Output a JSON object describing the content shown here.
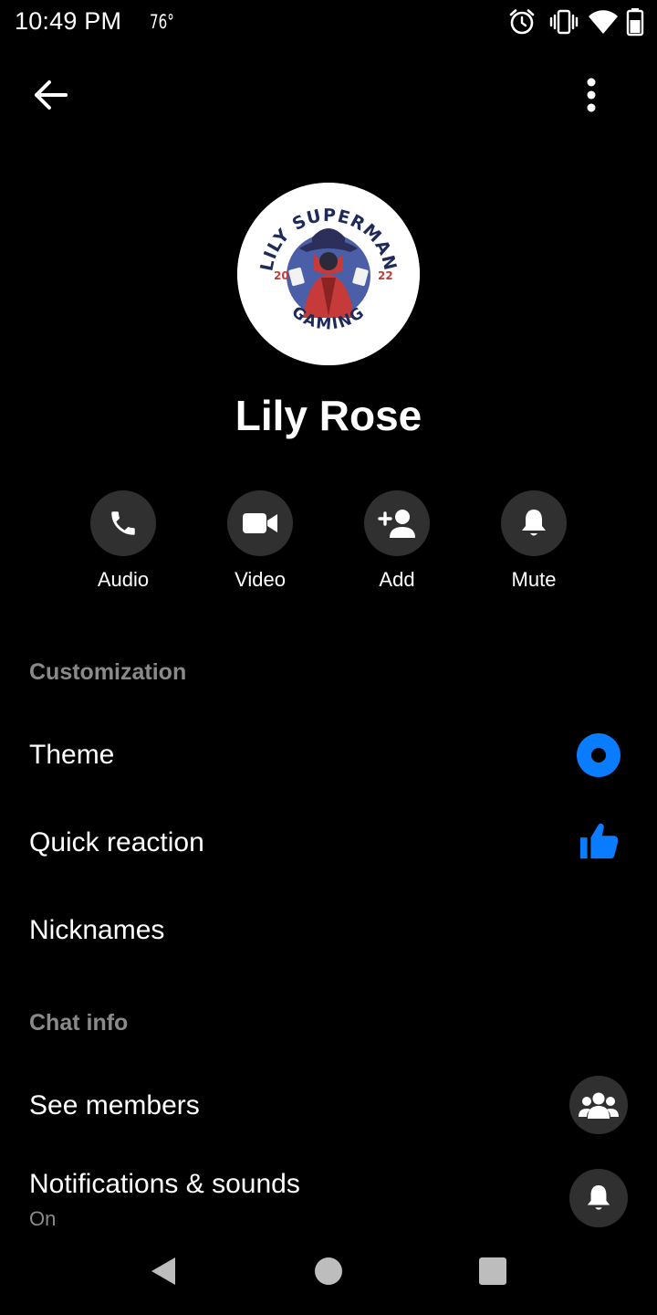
{
  "status_bar": {
    "time": "10:49 PM",
    "temperature": "76°",
    "icons": [
      "alarm-icon",
      "vibrate-icon",
      "wifi-icon",
      "battery-icon"
    ]
  },
  "top_bar": {
    "icons": [
      "back-arrow-icon",
      "more-vertical-icon"
    ]
  },
  "profile": {
    "avatar_text": {
      "top": "LILY SUPERMAN",
      "left": "20",
      "right": "22",
      "bottom": "GAMING"
    },
    "name": "Lily Rose"
  },
  "actions": [
    {
      "label": "Audio",
      "icon": "phone-icon"
    },
    {
      "label": "Video",
      "icon": "video-camera-icon"
    },
    {
      "label": "Add",
      "icon": "add-person-icon"
    },
    {
      "label": "Mute",
      "icon": "bell-icon"
    }
  ],
  "customization": {
    "header": "Customization",
    "theme_label": "Theme",
    "quick_reaction_label": "Quick reaction",
    "nicknames_label": "Nicknames"
  },
  "chat_info": {
    "header": "Chat info",
    "see_members_label": "See members",
    "notifications_label": "Notifications & sounds",
    "notifications_status": "On"
  },
  "colors": {
    "background": "#000000",
    "accent": "#0a7cff",
    "button_bg": "#303030",
    "muted_text": "#8a8a8a"
  },
  "nav_bar": {
    "icons": [
      "back-triangle-icon",
      "home-circle-icon",
      "recents-square-icon"
    ]
  }
}
